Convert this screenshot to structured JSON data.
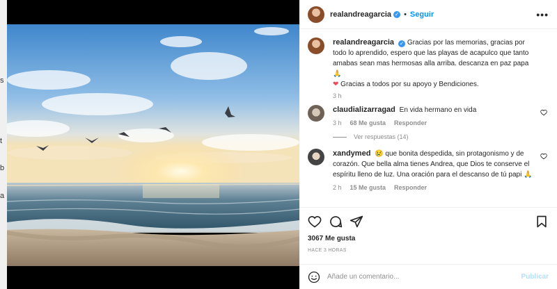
{
  "page_strip": {
    "fragments": [
      "s",
      "t",
      "b",
      "a"
    ]
  },
  "post": {
    "author": "realandreagarcia",
    "follow_label": "Seguir",
    "more_label": "•••",
    "caption": "Gracias por las memorias, gracias por todo lo aprendido, espero que las playas de acapulco que tanto amabas sean mas hermosas alla arriba. descanza en paz papa 🙏",
    "caption_line2": "Gracias a todos por su apoyo y Bendiciones.",
    "caption_time": "3 h",
    "likes": "3067 Me gusta",
    "posted_ago": "HACE 3 HORAS"
  },
  "comments": [
    {
      "user": "claudializarragad",
      "text": "En vida hermano en vida",
      "time": "3 h",
      "likes": "68 Me gusta",
      "reply_label": "Responder"
    },
    {
      "user": "xandymed",
      "text": "😢 que bonita despedida, sin protagonismo y de corazón. Que bella alma tienes Andrea, que Dios te conserve el espíritu lleno de luz. Una oración para el descanso de tú papi 🙏",
      "time": "2 h",
      "likes": "15 Me gusta",
      "reply_label": "Responder"
    }
  ],
  "view_replies": "Ver respuestas (14)",
  "add_comment": {
    "placeholder": "Añade un comentario...",
    "publish_label": "Publicar"
  },
  "colors": {
    "accent": "#0095f6",
    "heart": "#ed4956",
    "verified": "#3897f0",
    "publish_disabled": "#b2dffc"
  }
}
